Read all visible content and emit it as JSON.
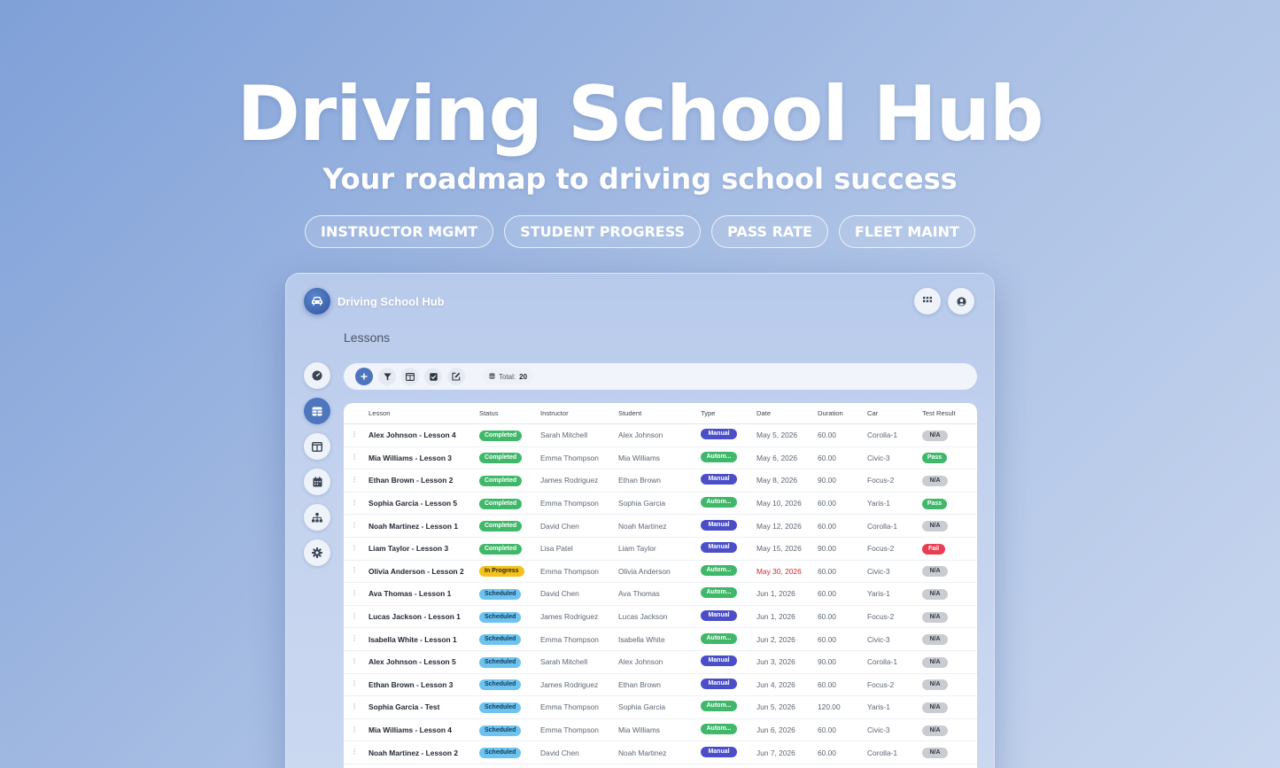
{
  "hero": {
    "title": "Driving School Hub",
    "subtitle": "Your roadmap to driving school success",
    "pills": [
      "INSTRUCTOR MGMT",
      "STUDENT PROGRESS",
      "PASS RATE",
      "FLEET MAINT"
    ]
  },
  "app": {
    "title": "Driving School Hub",
    "page_heading": "Lessons",
    "total_label": "Total:",
    "total_value": "20"
  },
  "icons": {
    "logo": "car-icon",
    "apps": "grid-icon",
    "user": "user-circle-icon",
    "nav": [
      "dashboard-icon",
      "table-icon",
      "columns-icon",
      "calendar-icon",
      "sitemap-icon",
      "gear-icon"
    ],
    "toolbar": [
      "plus-icon",
      "filter-icon",
      "columns-icon",
      "checkbox-icon",
      "edit-icon",
      "database-icon"
    ]
  },
  "colors": {
    "accent": "#4d76bd",
    "completed": "#3fb86a",
    "in_progress": "#f4c21b",
    "scheduled": "#6cc3ef",
    "manual": "#4b4ec9",
    "automatic": "#3fb86a",
    "fail": "#ea3d52",
    "overdue_date": "#d4272f"
  },
  "table": {
    "columns": [
      "Lesson",
      "Status",
      "Instructor",
      "Student",
      "Type",
      "Date",
      "Duration",
      "Car",
      "Test Result"
    ],
    "rows": [
      {
        "lesson": "Alex Johnson - Lesson 4",
        "status": "Completed",
        "instructor": "Sarah Mitchell",
        "student": "Alex Johnson",
        "type": "Manual",
        "date": "May 5, 2026",
        "duration": "60.00",
        "car": "Corolla-1",
        "test": "N/A"
      },
      {
        "lesson": "Mia Williams - Lesson 3",
        "status": "Completed",
        "instructor": "Emma Thompson",
        "student": "Mia Williams",
        "type": "Autom...",
        "date": "May 6, 2026",
        "duration": "60.00",
        "car": "Civic-3",
        "test": "Pass"
      },
      {
        "lesson": "Ethan Brown - Lesson 2",
        "status": "Completed",
        "instructor": "James Rodriguez",
        "student": "Ethan Brown",
        "type": "Manual",
        "date": "May 8, 2026",
        "duration": "90.00",
        "car": "Focus-2",
        "test": "N/A"
      },
      {
        "lesson": "Sophia Garcia - Lesson 5",
        "status": "Completed",
        "instructor": "Emma Thompson",
        "student": "Sophia Garcia",
        "type": "Autom...",
        "date": "May 10, 2026",
        "duration": "60.00",
        "car": "Yaris-1",
        "test": "Pass"
      },
      {
        "lesson": "Noah Martinez - Lesson 1",
        "status": "Completed",
        "instructor": "David Chen",
        "student": "Noah Martinez",
        "type": "Manual",
        "date": "May 12, 2026",
        "duration": "60.00",
        "car": "Corolla-1",
        "test": "N/A"
      },
      {
        "lesson": "Liam Taylor - Lesson 3",
        "status": "Completed",
        "instructor": "Lisa Patel",
        "student": "Liam Taylor",
        "type": "Manual",
        "date": "May 15, 2026",
        "duration": "90.00",
        "car": "Focus-2",
        "test": "Fail"
      },
      {
        "lesson": "Olivia Anderson - Lesson 2",
        "status": "In Progress",
        "instructor": "Emma Thompson",
        "student": "Olivia Anderson",
        "type": "Autom...",
        "date": "May 30, 2026",
        "duration": "60.00",
        "car": "Civic-3",
        "test": "N/A",
        "overdue": true
      },
      {
        "lesson": "Ava Thomas - Lesson 1",
        "status": "Scheduled",
        "instructor": "David Chen",
        "student": "Ava Thomas",
        "type": "Autom...",
        "date": "Jun 1, 2026",
        "duration": "60.00",
        "car": "Yaris-1",
        "test": "N/A"
      },
      {
        "lesson": "Lucas Jackson - Lesson 1",
        "status": "Scheduled",
        "instructor": "James Rodriguez",
        "student": "Lucas Jackson",
        "type": "Manual",
        "date": "Jun 1, 2026",
        "duration": "60.00",
        "car": "Focus-2",
        "test": "N/A"
      },
      {
        "lesson": "Isabella White - Lesson 1",
        "status": "Scheduled",
        "instructor": "Emma Thompson",
        "student": "Isabella White",
        "type": "Autom...",
        "date": "Jun 2, 2026",
        "duration": "60.00",
        "car": "Civic-3",
        "test": "N/A"
      },
      {
        "lesson": "Alex Johnson - Lesson 5",
        "status": "Scheduled",
        "instructor": "Sarah Mitchell",
        "student": "Alex Johnson",
        "type": "Manual",
        "date": "Jun 3, 2026",
        "duration": "90.00",
        "car": "Corolla-1",
        "test": "N/A"
      },
      {
        "lesson": "Ethan Brown - Lesson 3",
        "status": "Scheduled",
        "instructor": "James Rodriguez",
        "student": "Ethan Brown",
        "type": "Manual",
        "date": "Jun 4, 2026",
        "duration": "60.00",
        "car": "Focus-2",
        "test": "N/A"
      },
      {
        "lesson": "Sophia Garcia - Test",
        "status": "Scheduled",
        "instructor": "Emma Thompson",
        "student": "Sophia Garcia",
        "type": "Autom...",
        "date": "Jun 5, 2026",
        "duration": "120.00",
        "car": "Yaris-1",
        "test": "N/A"
      },
      {
        "lesson": "Mia Williams - Lesson 4",
        "status": "Scheduled",
        "instructor": "Emma Thompson",
        "student": "Mia Williams",
        "type": "Autom...",
        "date": "Jun 6, 2026",
        "duration": "60.00",
        "car": "Civic-3",
        "test": "N/A"
      },
      {
        "lesson": "Noah Martinez - Lesson 2",
        "status": "Scheduled",
        "instructor": "David Chen",
        "student": "Noah Martinez",
        "type": "Manual",
        "date": "Jun 7, 2026",
        "duration": "60.00",
        "car": "Corolla-1",
        "test": "N/A"
      }
    ]
  }
}
